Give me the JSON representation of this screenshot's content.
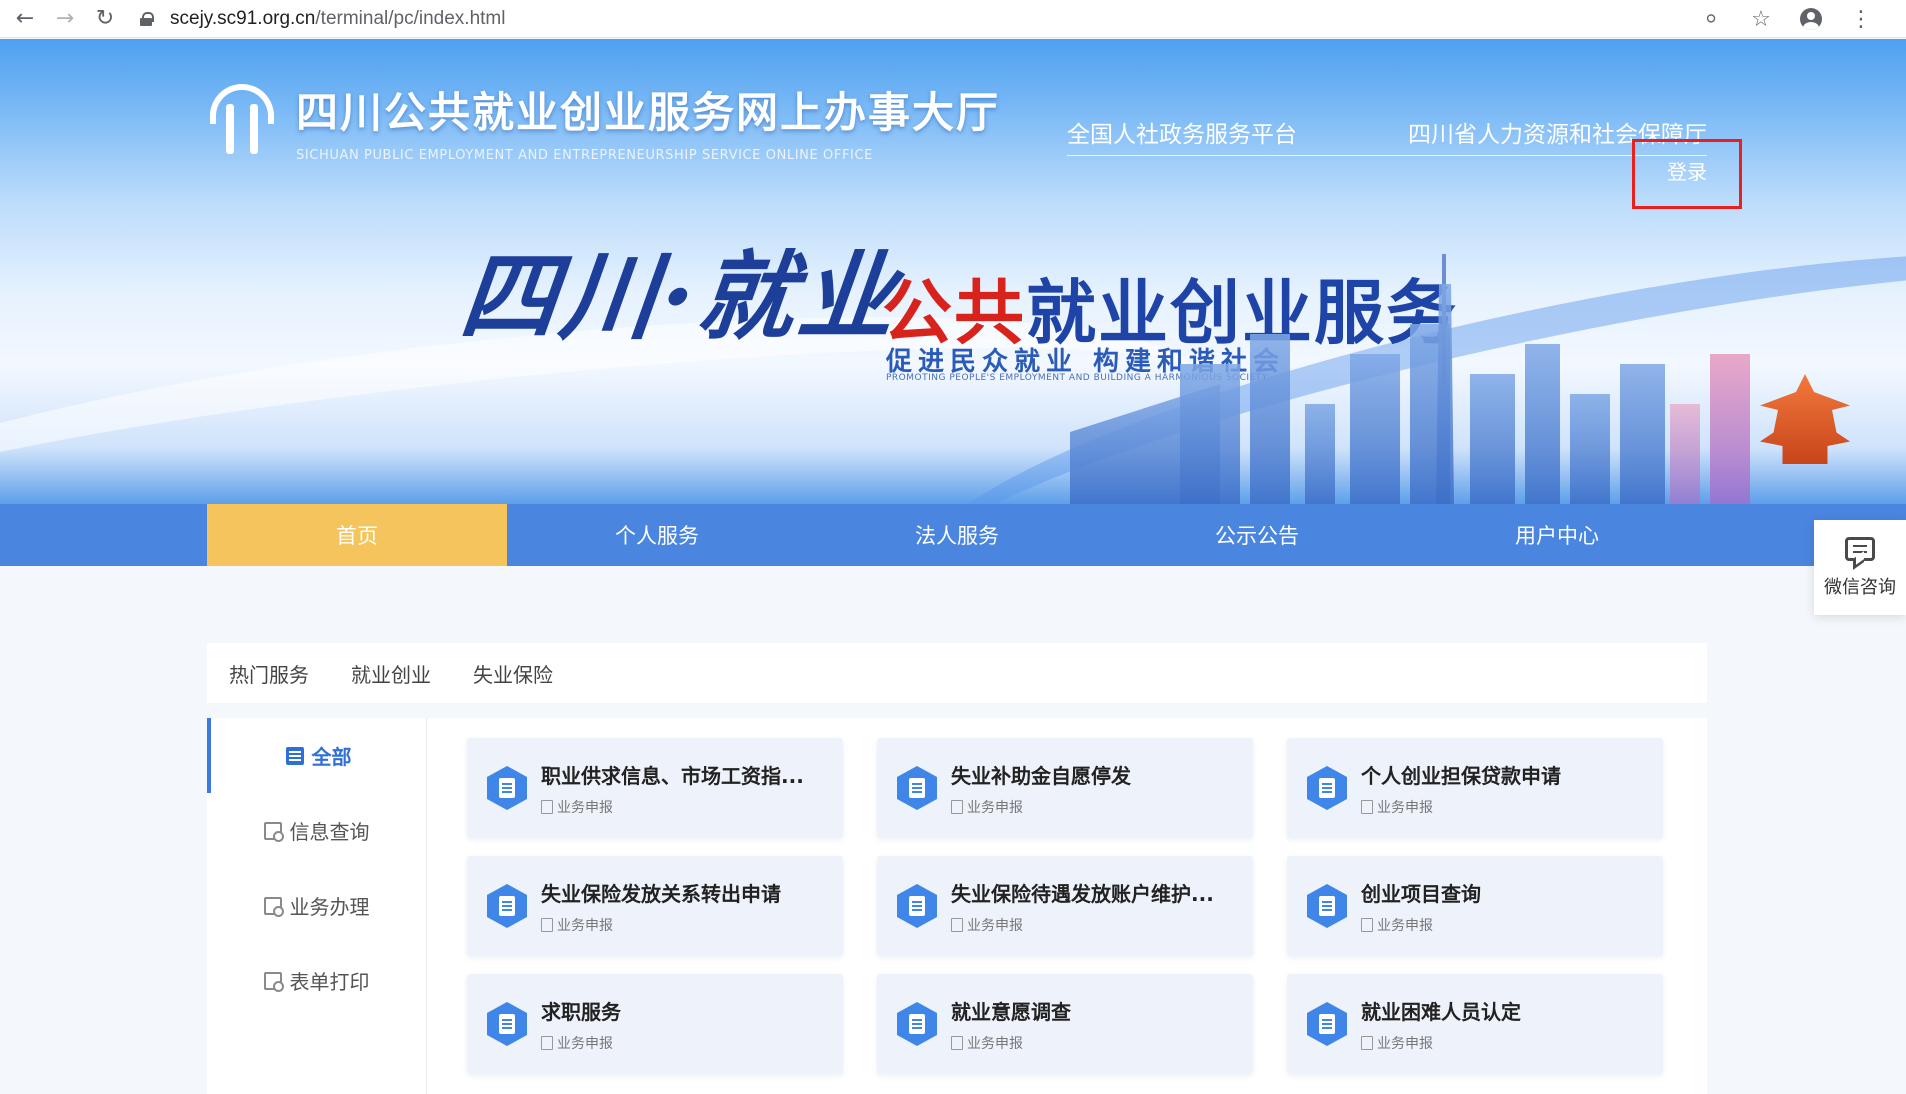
{
  "browser": {
    "url_host": "scejy.sc91.org.cn",
    "url_path": "/terminal/pc/index.html"
  },
  "header": {
    "logo_cn": "四川公共就业创业服务网上办事大厅",
    "logo_en": "SICHUAN PUBLIC EMPLOYMENT AND ENTREPRENEURSHIP SERVICE ONLINE OFFICE",
    "links": [
      "全国人社政务服务平台",
      "四川省人力资源和社会保障厅"
    ],
    "login": "登录"
  },
  "banner": {
    "slogan_left": "四川·就业",
    "title_red": "公共",
    "title_blue": "就业创业服务",
    "subtitle": "促进民众就业  构建和谐社会",
    "subtitle_en": "PROMOTING PEOPLE'S EMPLOYMENT AND BUILDING A HARMONIOUS SOCIETY"
  },
  "nav": {
    "items": [
      "首页",
      "个人服务",
      "法人服务",
      "公示公告",
      "用户中心"
    ],
    "active_index": 0
  },
  "float": {
    "wechat_label": "微信咨询"
  },
  "services": {
    "tabs": [
      "热门服务",
      "就业创业",
      "失业保险"
    ],
    "side_menu": [
      "全部",
      "信息查询",
      "业务办理",
      "表单打印"
    ],
    "cards": [
      {
        "title": "职业供求信息、市场工资指...",
        "sub": "业务申报"
      },
      {
        "title": "失业补助金自愿停发",
        "sub": "业务申报"
      },
      {
        "title": "个人创业担保贷款申请",
        "sub": "业务申报"
      },
      {
        "title": "失业保险发放关系转出申请",
        "sub": "业务申报"
      },
      {
        "title": "失业保险待遇发放账户维护...",
        "sub": "业务申报"
      },
      {
        "title": "创业项目查询",
        "sub": "业务申报"
      },
      {
        "title": "求职服务",
        "sub": "业务申报"
      },
      {
        "title": "就业意愿调查",
        "sub": "业务申报"
      },
      {
        "title": "就业困难人员认定",
        "sub": "业务申报"
      }
    ]
  },
  "colors": {
    "nav_bg": "#4a85e0",
    "nav_active": "#f6c45c",
    "login_highlight": "#e82020",
    "accent_blue": "#2f6fd8"
  }
}
